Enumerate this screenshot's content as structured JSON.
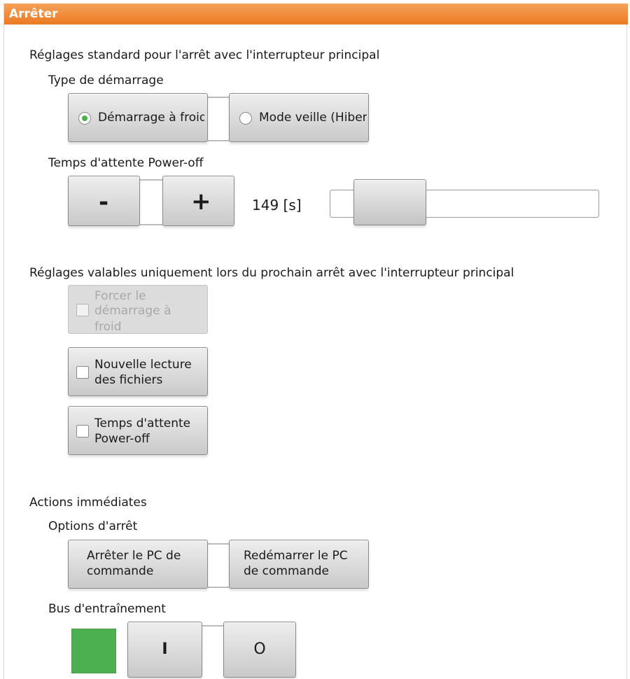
{
  "title": "Arrêter",
  "standard": {
    "heading": "Réglages standard pour l'arrêt avec l'interrupteur principal",
    "startup_type_label": "Type de démarrage",
    "startup_options": [
      "Démarrage à froid",
      "Mode veille (Hibernation)"
    ],
    "startup_selected": 0,
    "wait_time_label": "Temps d'attente Power-off",
    "decrement_label": "-",
    "increment_label": "+",
    "wait_time_value": "149 [s]",
    "wait_time_seconds": 149,
    "slider_fraction": 0.12
  },
  "next_shutdown": {
    "heading": "Réglages valables uniquement lors du prochain arrêt avec l'interrupteur principal",
    "options": [
      {
        "line1": "Forcer le",
        "line2": "démarrage à",
        "line3": "froid",
        "checked": false,
        "enabled": false
      },
      {
        "line1": "Nouvelle lecture",
        "line2": "des fichiers",
        "checked": false,
        "enabled": true
      },
      {
        "line1": "Temps d'attente",
        "line2": "Power-off",
        "checked": false,
        "enabled": true
      }
    ]
  },
  "immediate": {
    "heading": "Actions immédiates",
    "shutdown_options_label": "Options d'arrêt",
    "shutdown_pc": {
      "line1": "Arrêter le PC de",
      "line2": "commande"
    },
    "restart_pc": {
      "line1": "Redémarrer le PC",
      "line2": "de commande"
    },
    "drive_bus_label": "Bus d'entraînement",
    "drive_bus_on_label": "I",
    "drive_bus_off_label": "O",
    "drive_bus_status_color": "#4caf50"
  },
  "colors": {
    "title_bar": "#ec7a22",
    "accent_green": "#4caf50"
  }
}
